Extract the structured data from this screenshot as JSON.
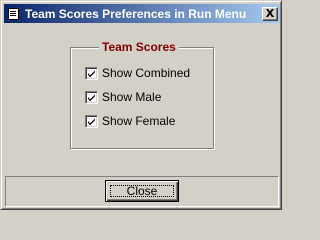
{
  "window": {
    "title": "Team Scores Preferences in Run Menu",
    "close_glyph": "X",
    "icon": "app-window-icon"
  },
  "group": {
    "legend": "Team Scores",
    "legend_color": "#800000",
    "options": [
      {
        "label": "Show Combined",
        "checked": true
      },
      {
        "label": "Show Male",
        "checked": true
      },
      {
        "label": "Show Female",
        "checked": true
      }
    ]
  },
  "footer": {
    "close_label": "Close"
  }
}
